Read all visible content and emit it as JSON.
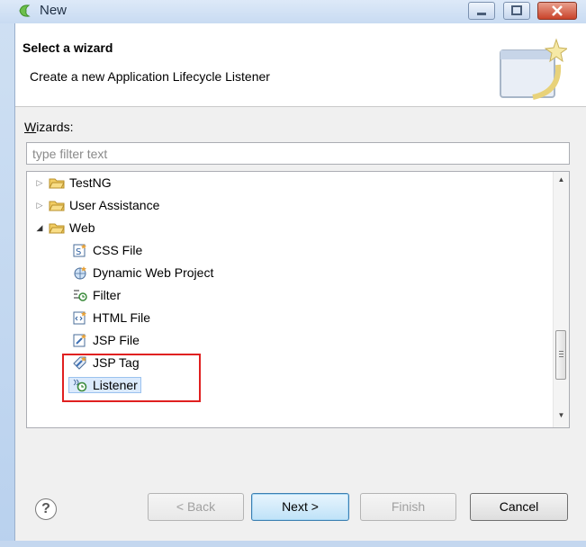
{
  "window": {
    "title": "New"
  },
  "header": {
    "title": "Select a wizard",
    "description": "Create a new Application Lifecycle Listener"
  },
  "wizards": {
    "label_first": "W",
    "label_rest": "izards:",
    "filter_placeholder": "type filter text",
    "items": [
      {
        "label": "TestNG",
        "icon": "folder-icon",
        "expanded": false
      },
      {
        "label": "User Assistance",
        "icon": "folder-icon",
        "expanded": false
      },
      {
        "label": "Web",
        "icon": "folder-icon",
        "expanded": true
      },
      {
        "label": "CSS File",
        "icon": "css-file-icon"
      },
      {
        "label": "Dynamic Web Project",
        "icon": "web-project-icon"
      },
      {
        "label": "Filter",
        "icon": "filter-icon"
      },
      {
        "label": "HTML File",
        "icon": "html-file-icon"
      },
      {
        "label": "JSP File",
        "icon": "jsp-file-icon"
      },
      {
        "label": "JSP Tag",
        "icon": "jsp-tag-icon"
      },
      {
        "label": "Listener",
        "icon": "listener-icon",
        "selected": true
      }
    ]
  },
  "buttons": {
    "help": "?",
    "back": "< Back",
    "next": "Next >",
    "finish": "Finish",
    "cancel": "Cancel"
  },
  "colors": {
    "selection": "#dbeafc",
    "highlight_box": "#e02020",
    "folder": "#f2cd62"
  }
}
